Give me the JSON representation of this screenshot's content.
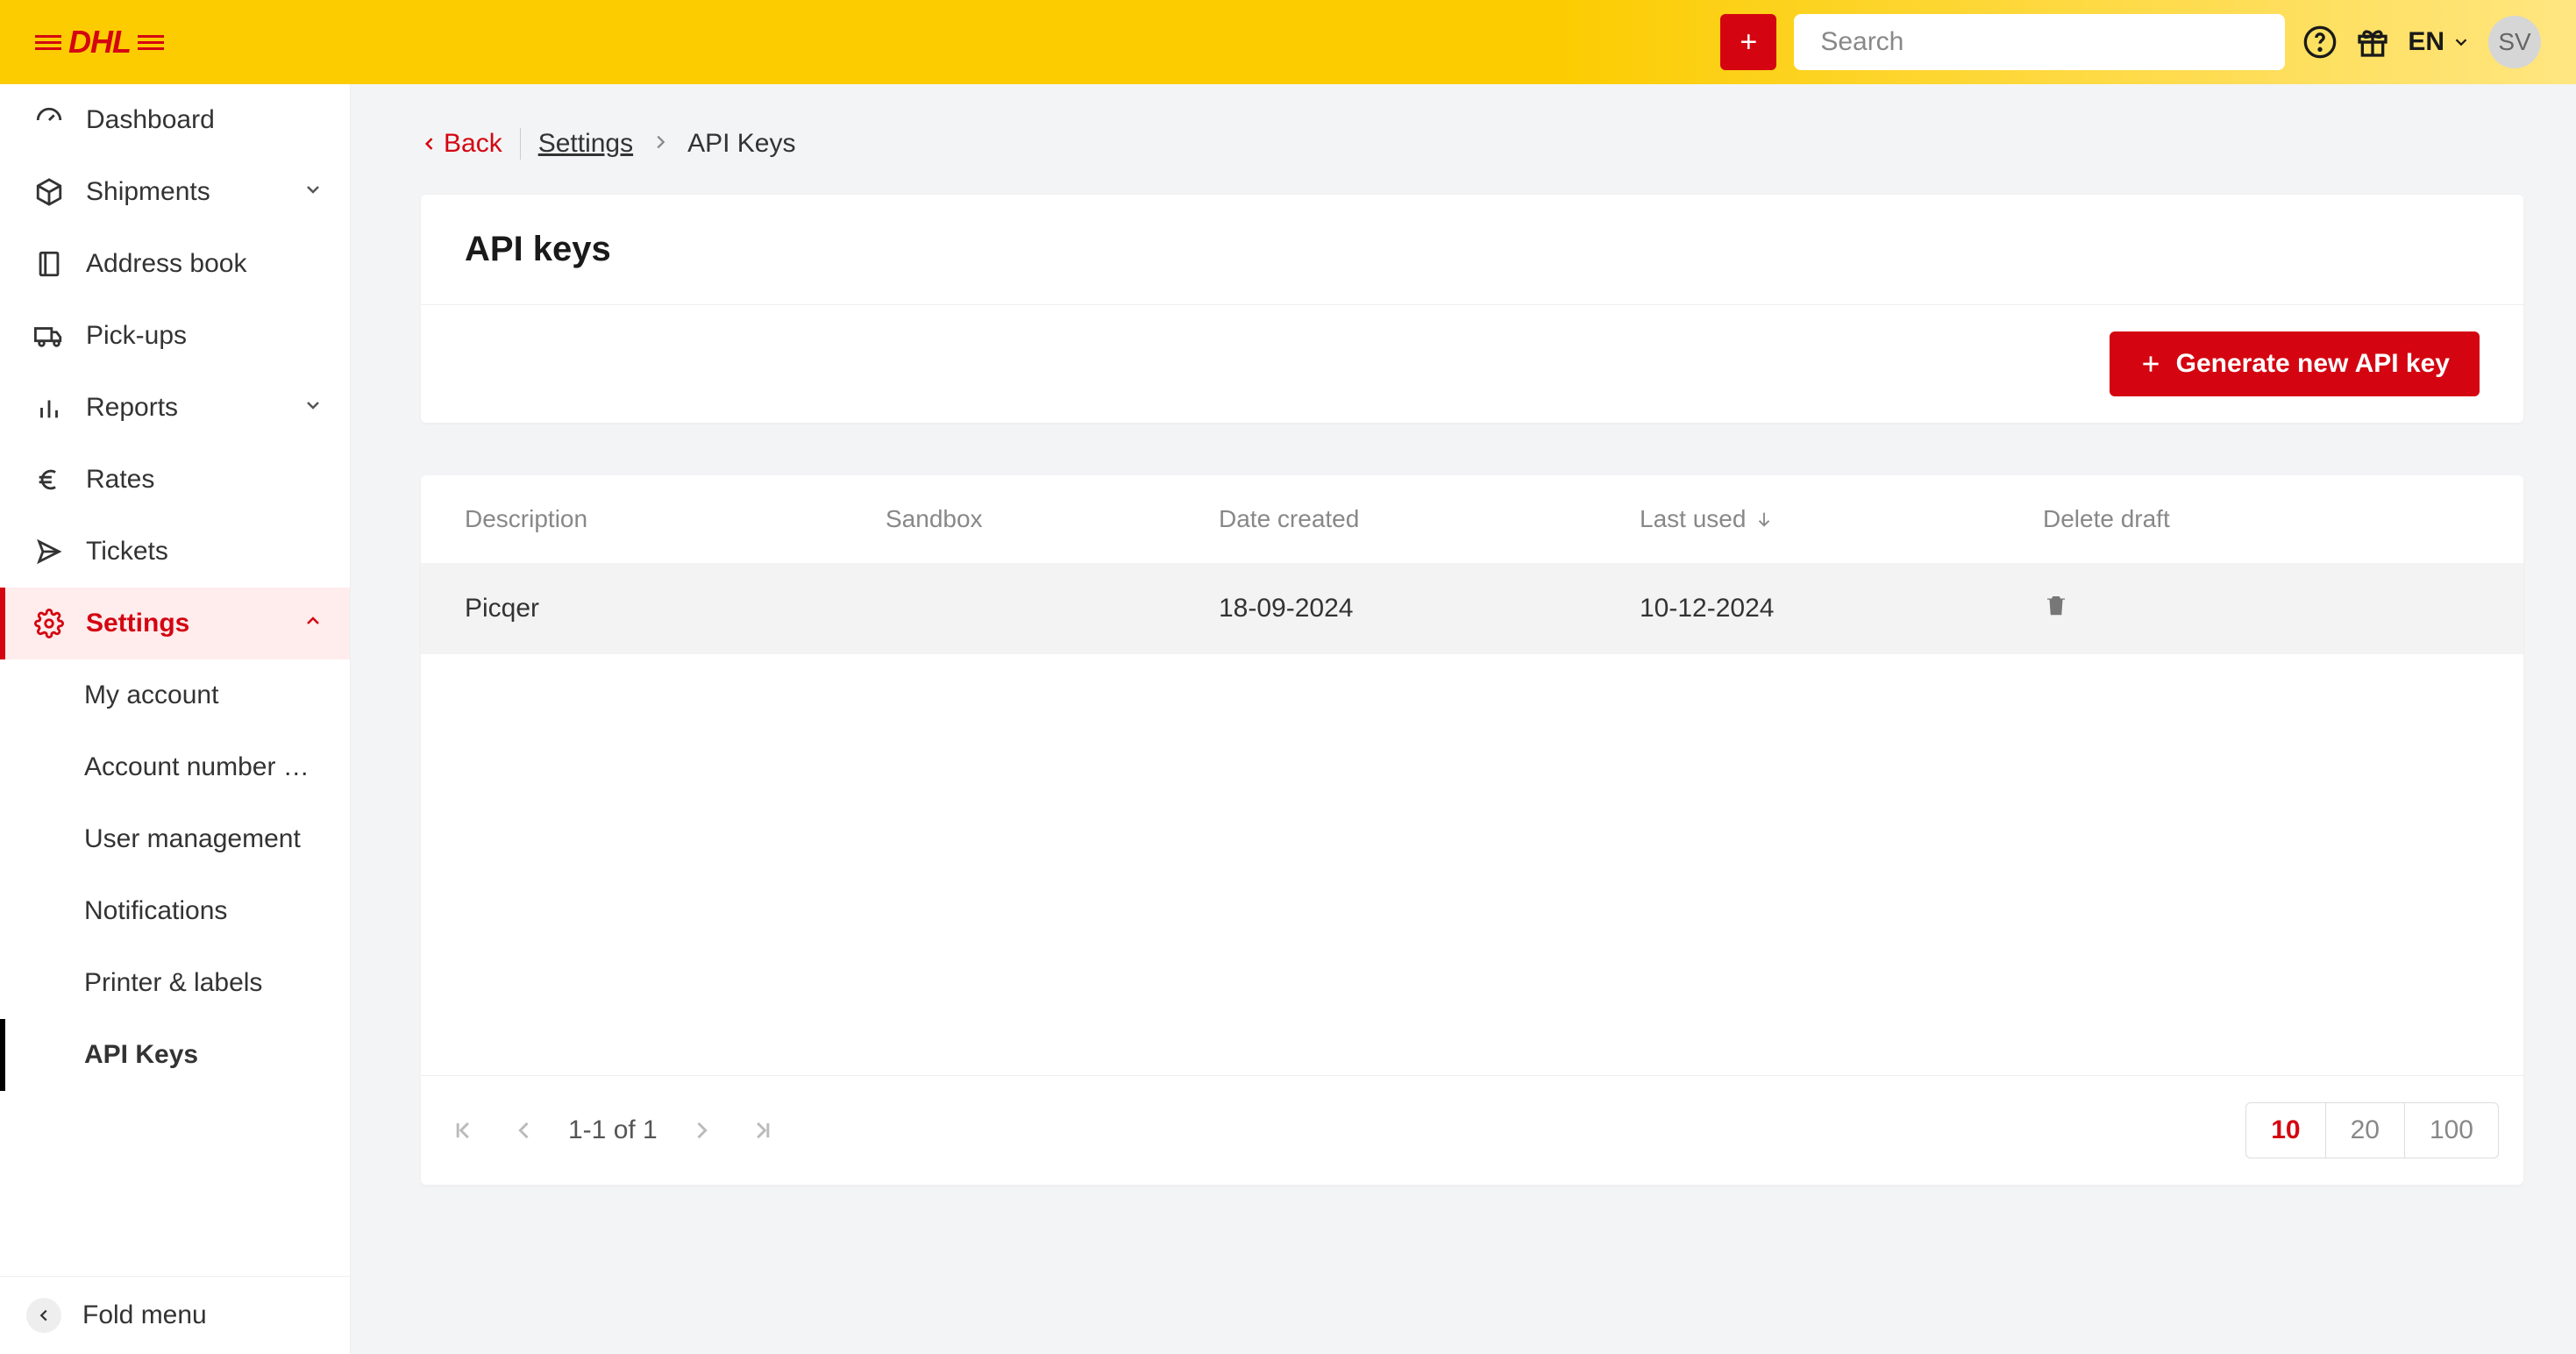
{
  "header": {
    "search_placeholder": "Search",
    "language": "EN",
    "avatar_initials": "SV"
  },
  "sidebar": {
    "items": [
      {
        "label": "Dashboard"
      },
      {
        "label": "Shipments"
      },
      {
        "label": "Address book"
      },
      {
        "label": "Pick-ups"
      },
      {
        "label": "Reports"
      },
      {
        "label": "Rates"
      },
      {
        "label": "Tickets"
      },
      {
        "label": "Settings"
      }
    ],
    "settings_children": [
      {
        "label": "My account"
      },
      {
        "label": "Account number …"
      },
      {
        "label": "User management"
      },
      {
        "label": "Notifications"
      },
      {
        "label": "Printer & labels"
      },
      {
        "label": "API Keys"
      }
    ],
    "fold_label": "Fold menu"
  },
  "breadcrumb": {
    "back": "Back",
    "settings": "Settings",
    "current": "API Keys"
  },
  "page": {
    "title": "API keys",
    "generate_button": "Generate new API key"
  },
  "table": {
    "columns": {
      "description": "Description",
      "sandbox": "Sandbox",
      "date_created": "Date created",
      "last_used": "Last used",
      "delete_draft": "Delete draft"
    },
    "rows": [
      {
        "description": "Picqer",
        "sandbox": "",
        "date_created": "18-09-2024",
        "last_used": "10-12-2024"
      }
    ]
  },
  "pagination": {
    "info": "1-1 of 1",
    "sizes": [
      "10",
      "20",
      "100"
    ],
    "active_size": "10"
  }
}
